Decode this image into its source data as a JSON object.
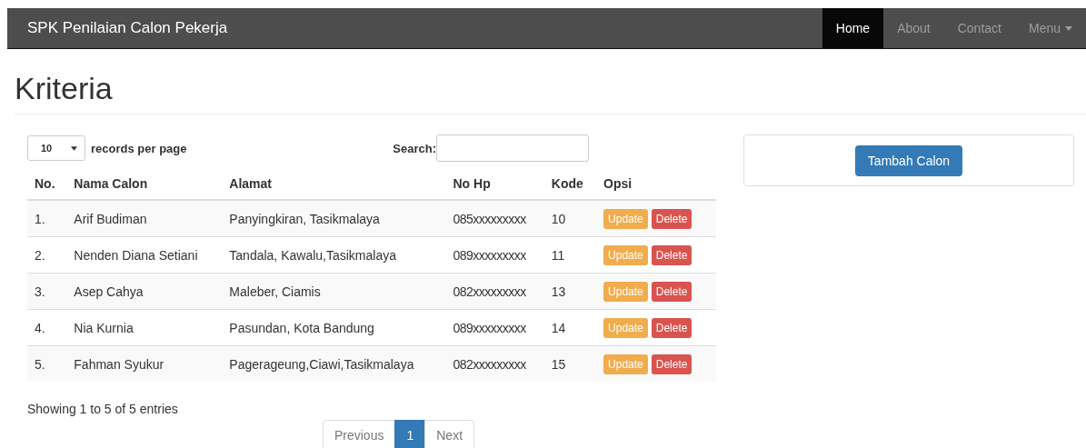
{
  "navbar": {
    "brand": "SPK Penilaian Calon Pekerja",
    "items": [
      {
        "label": "Home",
        "selected": true,
        "kind": "link"
      },
      {
        "label": "About",
        "selected": false,
        "kind": "link"
      },
      {
        "label": "Contact",
        "selected": false,
        "kind": "link"
      },
      {
        "label": "Menu",
        "selected": false,
        "kind": "dropdown"
      }
    ]
  },
  "page_title": "Kriteria",
  "table_controls": {
    "page_size": "10",
    "page_size_label": "records per page",
    "search_label": "Search:"
  },
  "table": {
    "columns": [
      "No.",
      "Nama Calon",
      "Alamat",
      "No Hp",
      "Kode",
      "Opsi"
    ],
    "rows": [
      {
        "no": "1.",
        "nama": "Arif Budiman",
        "alamat": "Panyingkiran, Tasikmalaya",
        "hp": "085xxxxxxxxx",
        "kode": "10",
        "actions": [
          "Update",
          "Delete"
        ]
      },
      {
        "no": "2.",
        "nama": "Nenden Diana Setiani",
        "alamat": "Tandala, Kawalu,Tasikmalaya",
        "hp": "089xxxxxxxxx",
        "kode": "11",
        "actions": [
          "Update",
          "Delete"
        ]
      },
      {
        "no": "3.",
        "nama": "Asep Cahya",
        "alamat": "Maleber, Ciamis",
        "hp": "082xxxxxxxxx",
        "kode": "13",
        "actions": [
          "Update",
          "Delete"
        ]
      },
      {
        "no": "4.",
        "nama": "Nia Kurnia",
        "alamat": "Pasundan, Kota Bandung",
        "hp": "089xxxxxxxxx",
        "kode": "14",
        "actions": [
          "Update",
          "Delete"
        ]
      },
      {
        "no": "5.",
        "nama": "Fahman Syukur",
        "alamat": "Pagerageung,Ciawi,Tasikmalaya",
        "hp": "082xxxxxxxxx",
        "kode": "15",
        "actions": [
          "Update",
          "Delete"
        ]
      }
    ]
  },
  "info": "Showing 1 to 5 of 5 entries",
  "pagination": [
    {
      "label": "Previous",
      "selected": false
    },
    {
      "label": "1",
      "selected": true
    },
    {
      "label": "Next",
      "selected": false
    }
  ],
  "side_panel": {
    "button": "Tambah Calon"
  }
}
